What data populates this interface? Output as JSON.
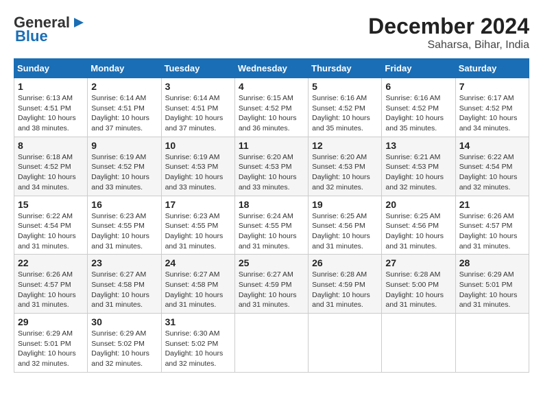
{
  "logo": {
    "text1": "General",
    "text2": "Blue"
  },
  "title": "December 2024",
  "subtitle": "Saharsa, Bihar, India",
  "days_of_week": [
    "Sunday",
    "Monday",
    "Tuesday",
    "Wednesday",
    "Thursday",
    "Friday",
    "Saturday"
  ],
  "weeks": [
    [
      {
        "day": "1",
        "info": "Sunrise: 6:13 AM\nSunset: 4:51 PM\nDaylight: 10 hours\nand 38 minutes."
      },
      {
        "day": "2",
        "info": "Sunrise: 6:14 AM\nSunset: 4:51 PM\nDaylight: 10 hours\nand 37 minutes."
      },
      {
        "day": "3",
        "info": "Sunrise: 6:14 AM\nSunset: 4:51 PM\nDaylight: 10 hours\nand 37 minutes."
      },
      {
        "day": "4",
        "info": "Sunrise: 6:15 AM\nSunset: 4:52 PM\nDaylight: 10 hours\nand 36 minutes."
      },
      {
        "day": "5",
        "info": "Sunrise: 6:16 AM\nSunset: 4:52 PM\nDaylight: 10 hours\nand 35 minutes."
      },
      {
        "day": "6",
        "info": "Sunrise: 6:16 AM\nSunset: 4:52 PM\nDaylight: 10 hours\nand 35 minutes."
      },
      {
        "day": "7",
        "info": "Sunrise: 6:17 AM\nSunset: 4:52 PM\nDaylight: 10 hours\nand 34 minutes."
      }
    ],
    [
      {
        "day": "8",
        "info": "Sunrise: 6:18 AM\nSunset: 4:52 PM\nDaylight: 10 hours\nand 34 minutes."
      },
      {
        "day": "9",
        "info": "Sunrise: 6:19 AM\nSunset: 4:52 PM\nDaylight: 10 hours\nand 33 minutes."
      },
      {
        "day": "10",
        "info": "Sunrise: 6:19 AM\nSunset: 4:53 PM\nDaylight: 10 hours\nand 33 minutes."
      },
      {
        "day": "11",
        "info": "Sunrise: 6:20 AM\nSunset: 4:53 PM\nDaylight: 10 hours\nand 33 minutes."
      },
      {
        "day": "12",
        "info": "Sunrise: 6:20 AM\nSunset: 4:53 PM\nDaylight: 10 hours\nand 32 minutes."
      },
      {
        "day": "13",
        "info": "Sunrise: 6:21 AM\nSunset: 4:53 PM\nDaylight: 10 hours\nand 32 minutes."
      },
      {
        "day": "14",
        "info": "Sunrise: 6:22 AM\nSunset: 4:54 PM\nDaylight: 10 hours\nand 32 minutes."
      }
    ],
    [
      {
        "day": "15",
        "info": "Sunrise: 6:22 AM\nSunset: 4:54 PM\nDaylight: 10 hours\nand 31 minutes."
      },
      {
        "day": "16",
        "info": "Sunrise: 6:23 AM\nSunset: 4:55 PM\nDaylight: 10 hours\nand 31 minutes."
      },
      {
        "day": "17",
        "info": "Sunrise: 6:23 AM\nSunset: 4:55 PM\nDaylight: 10 hours\nand 31 minutes."
      },
      {
        "day": "18",
        "info": "Sunrise: 6:24 AM\nSunset: 4:55 PM\nDaylight: 10 hours\nand 31 minutes."
      },
      {
        "day": "19",
        "info": "Sunrise: 6:25 AM\nSunset: 4:56 PM\nDaylight: 10 hours\nand 31 minutes."
      },
      {
        "day": "20",
        "info": "Sunrise: 6:25 AM\nSunset: 4:56 PM\nDaylight: 10 hours\nand 31 minutes."
      },
      {
        "day": "21",
        "info": "Sunrise: 6:26 AM\nSunset: 4:57 PM\nDaylight: 10 hours\nand 31 minutes."
      }
    ],
    [
      {
        "day": "22",
        "info": "Sunrise: 6:26 AM\nSunset: 4:57 PM\nDaylight: 10 hours\nand 31 minutes."
      },
      {
        "day": "23",
        "info": "Sunrise: 6:27 AM\nSunset: 4:58 PM\nDaylight: 10 hours\nand 31 minutes."
      },
      {
        "day": "24",
        "info": "Sunrise: 6:27 AM\nSunset: 4:58 PM\nDaylight: 10 hours\nand 31 minutes."
      },
      {
        "day": "25",
        "info": "Sunrise: 6:27 AM\nSunset: 4:59 PM\nDaylight: 10 hours\nand 31 minutes."
      },
      {
        "day": "26",
        "info": "Sunrise: 6:28 AM\nSunset: 4:59 PM\nDaylight: 10 hours\nand 31 minutes."
      },
      {
        "day": "27",
        "info": "Sunrise: 6:28 AM\nSunset: 5:00 PM\nDaylight: 10 hours\nand 31 minutes."
      },
      {
        "day": "28",
        "info": "Sunrise: 6:29 AM\nSunset: 5:01 PM\nDaylight: 10 hours\nand 31 minutes."
      }
    ],
    [
      {
        "day": "29",
        "info": "Sunrise: 6:29 AM\nSunset: 5:01 PM\nDaylight: 10 hours\nand 32 minutes."
      },
      {
        "day": "30",
        "info": "Sunrise: 6:29 AM\nSunset: 5:02 PM\nDaylight: 10 hours\nand 32 minutes."
      },
      {
        "day": "31",
        "info": "Sunrise: 6:30 AM\nSunset: 5:02 PM\nDaylight: 10 hours\nand 32 minutes."
      },
      {
        "day": "",
        "info": ""
      },
      {
        "day": "",
        "info": ""
      },
      {
        "day": "",
        "info": ""
      },
      {
        "day": "",
        "info": ""
      }
    ]
  ]
}
